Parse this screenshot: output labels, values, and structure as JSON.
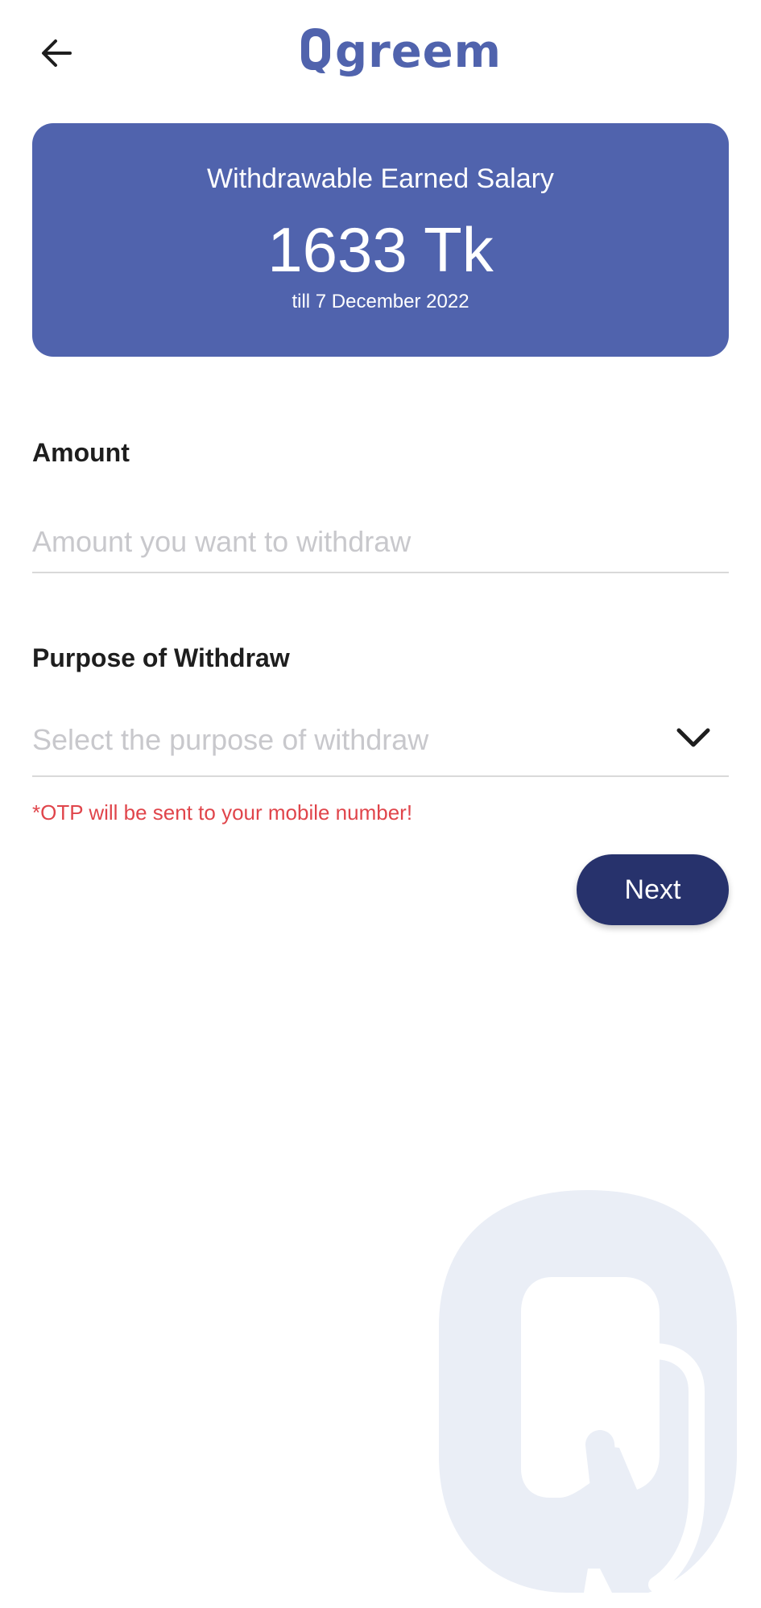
{
  "header": {
    "logo_text": "greem",
    "logo_letter": "Q",
    "back_icon": "arrow-left-icon"
  },
  "balance": {
    "title": "Withdrawable Earned Salary",
    "amount": "1633 Tk",
    "date": "till 7 December 2022"
  },
  "form": {
    "amount_label": "Amount",
    "amount_placeholder": "Amount you want to withdraw",
    "amount_value": "",
    "purpose_label": "Purpose of Withdraw",
    "purpose_placeholder": "Select the purpose of withdraw",
    "purpose_icon": "chevron-down-icon",
    "otp_note": "*OTP will be sent to your mobile number!",
    "next_label": "Next"
  },
  "colors": {
    "brand": "#5063ad",
    "button": "#27326c",
    "warning": "#e0454b",
    "watermark": "#eaeef6"
  }
}
